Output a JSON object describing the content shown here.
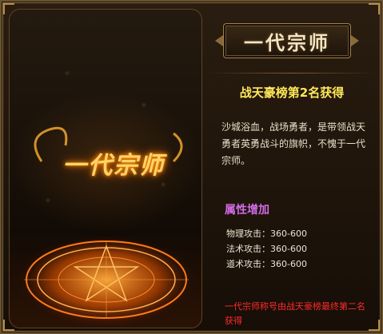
{
  "art": {
    "title_text": "一代宗师"
  },
  "info": {
    "banner_title": "一代宗师",
    "subtitle": "战天豪榜第2名获得",
    "description": "沙城浴血，战场勇者，是带领战天勇者英勇战斗的旗帜，不愧于一代宗师。",
    "attributes_heading": "属性增加",
    "stats": [
      {
        "label": "物理攻击：",
        "value": "360-600"
      },
      {
        "label": "法术攻击：",
        "value": "360-600"
      },
      {
        "label": "道术攻击：",
        "value": "360-600"
      }
    ],
    "note": "一代宗师称号由战天豪榜最终第二名获得"
  },
  "colors": {
    "subtitle": "#ffe85a",
    "attributes_heading": "#d36ce6",
    "note": "#ff2a2a"
  }
}
